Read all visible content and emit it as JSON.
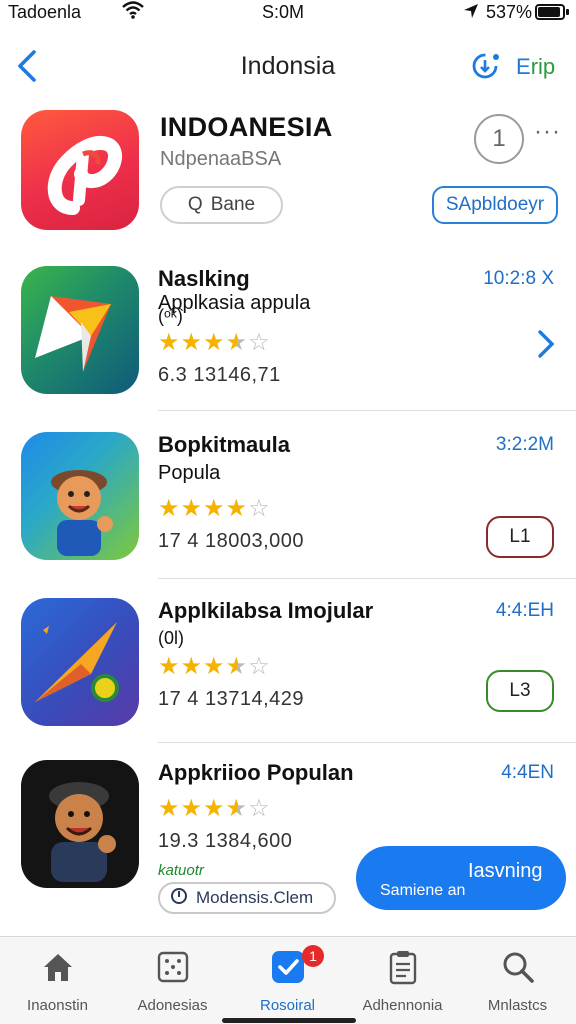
{
  "status_bar": {
    "carrier": "Tadoenla",
    "time": "S:0M",
    "battery_text": "537%",
    "battery_level": 0.9
  },
  "nav": {
    "title": "Indonsia",
    "right_label_part1": "E",
    "right_label_part2": "rip"
  },
  "featured": {
    "name": "INDOANESIA",
    "subtitle": "NdpenaaBSA",
    "search_label": "Bane",
    "search_glyph": "Q",
    "count": "1",
    "more": "···",
    "get_label": "SApbldoeyr"
  },
  "apps": [
    {
      "name": "Naslking",
      "subtitle": "Applkasia appula",
      "subtitle2": "(ᵒ͡ᵏ)",
      "rating": 3.5,
      "meta": "6.3   13146,71",
      "time": "10:2:8 X",
      "action": "chevron"
    },
    {
      "name": "Bopkitmaula",
      "subtitle": "Popula",
      "subtitle2": "",
      "rating": 4,
      "meta": "17 4   18003,000",
      "time": "3:2:2M",
      "action_label": "L1",
      "action_color": "#8a2a2a"
    },
    {
      "name": "Applkilabsa Imojular",
      "subtitle": "",
      "subtitle2": "(0l)",
      "rating": 3.5,
      "meta": "17 4   13714,429",
      "time": "4:4:EH",
      "action_label": "L3",
      "action_color": "#3a8a2a"
    },
    {
      "name": "Appkriioo Populan",
      "subtitle": "",
      "subtitle2": "",
      "rating": 3.5,
      "meta": "19.3   1384,600",
      "time": "4:4EN",
      "action": "none"
    }
  ],
  "last_row": {
    "green_note": "katuotr",
    "pill_label": "Modensis.Clem",
    "install_line1": "Iasvning",
    "install_line2": "Samiene an"
  },
  "tabs": [
    {
      "label": "Inaonstin",
      "icon": "home-icon"
    },
    {
      "label": "Adonesias",
      "icon": "dice-icon"
    },
    {
      "label": "Rosoiral",
      "icon": "check-badge-icon",
      "badge": "1",
      "active": true
    },
    {
      "label": "Adhennonia",
      "icon": "clipboard-icon"
    },
    {
      "label": "Mnlastcs",
      "icon": "search-icon"
    }
  ],
  "colors": {
    "accent": "#1f6fc8",
    "install_button": "#1a7af0",
    "star": "#f5b301",
    "badge": "#e62a2a"
  }
}
